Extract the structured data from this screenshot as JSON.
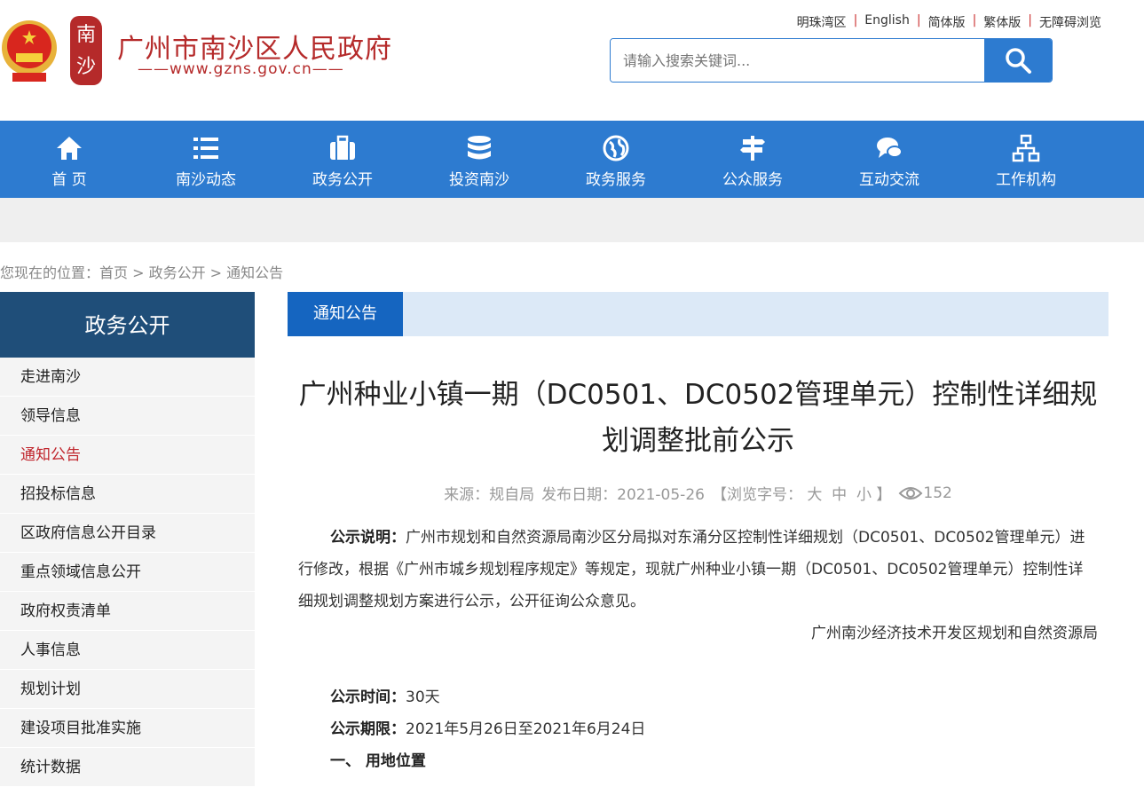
{
  "header": {
    "site_name": "广州市南沙区人民政府",
    "site_url": "——www.gzns.gov.cn——",
    "seal_text": "南沙",
    "top_links": [
      "明珠湾区",
      "English",
      "简体版",
      "繁体版",
      "无障碍浏览"
    ],
    "search_placeholder": "请输入搜索关键词..."
  },
  "nav": [
    {
      "label": "首 页",
      "icon": "home-icon"
    },
    {
      "label": "南沙动态",
      "icon": "list-icon"
    },
    {
      "label": "政务公开",
      "icon": "briefcase-icon"
    },
    {
      "label": "投资南沙",
      "icon": "database-icon"
    },
    {
      "label": "政务服务",
      "icon": "globe-icon"
    },
    {
      "label": "公众服务",
      "icon": "signpost-icon"
    },
    {
      "label": "互动交流",
      "icon": "chat-icon"
    },
    {
      "label": "工作机构",
      "icon": "org-chart-icon"
    }
  ],
  "breadcrumb": "您现在的位置：首页 > 政务公开 > 通知公告",
  "sidebar": {
    "title": "政务公开",
    "items": [
      "走进南沙",
      "领导信息",
      "通知公告",
      "招投标信息",
      "区政府信息公开目录",
      "重点领域信息公开",
      "政府权责清单",
      "人事信息",
      "规划计划",
      "建设项目批准实施",
      "统计数据"
    ]
  },
  "main": {
    "tab": "通知公告",
    "title": "广州种业小镇一期（DC0501、DC0502管理单元）控制性详细规划调整批前公示",
    "meta": {
      "source": "来源：规自局",
      "date": "发布日期：2021-05-26",
      "font_size": "【浏览字号：",
      "large": "大",
      "medium": "中",
      "small": "小",
      "close": "】",
      "views": "152"
    },
    "desc_label": "公示说明：",
    "desc": "广州市规划和自然资源局南沙区分局拟对东涌分区控制性详细规划（DC0501、DC0502管理单元）进行修改，根据《广州市城乡规划程序规定》等规定，现就广州种业小镇一期（DC0501、DC0502管理单元）控制性详细规划调整规划方案进行公示，公开征询公众意见。",
    "signature": "广州南沙经济技术开发区规划和自然资源局",
    "time_label": "公示时间：",
    "time": "30天",
    "period_label": "公示期限：",
    "period": "2021年5月26日至2021年6月24日",
    "section1": "一、 用地位置"
  }
}
